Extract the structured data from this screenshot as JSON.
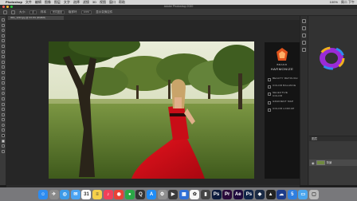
{
  "menubar": {
    "apple": "",
    "app_name": "Photoshop",
    "items": [
      "文件",
      "编辑",
      "图像",
      "图层",
      "文字",
      "选择",
      "滤镜",
      "3D",
      "视图",
      "窗口",
      "帮助"
    ],
    "right": [
      "100%",
      "周二 下午"
    ]
  },
  "window": {
    "title": "Adobe Photoshop 2020",
    "traffic_colors": [
      "#ff5f57",
      "#febc2e",
      "#28c840"
    ]
  },
  "options_bar": {
    "size_label": "大小:",
    "size_value": "点",
    "sample_label": "样本",
    "sample_value": "所有图层",
    "opacity_label": "显示变换控件",
    "strength_value": "100%",
    "extra_label": "取样环"
  },
  "document_tab": {
    "label": "IMG_1234.jpg @ 33.3% (RGB/8)"
  },
  "plugin": {
    "brand_top": "BRAND",
    "brand_name": "HARMONIZE",
    "accent": "#e0531c",
    "menu": [
      {
        "label": "BEAUTY RETOUCH"
      },
      {
        "label": "COLOR BALANCE"
      },
      {
        "label": "SELECTIVE COLOR"
      },
      {
        "label": "GRADIENT MAP"
      },
      {
        "label": "COLOR LOOKUP"
      }
    ]
  },
  "layers": {
    "header": "图层",
    "layer_name": "背景",
    "eye_icon": "eye-icon"
  },
  "dock": {
    "apps": [
      {
        "name": "finder-icon",
        "glyph": "☺",
        "color": "#2d8cf0"
      },
      {
        "name": "launchpad-icon",
        "glyph": "✈",
        "color": "#8a8a8a"
      },
      {
        "name": "safari-icon",
        "glyph": "◎",
        "color": "#3c9ae8"
      },
      {
        "name": "mail-icon",
        "glyph": "✉",
        "color": "#4aa3f2"
      },
      {
        "name": "calendar-icon",
        "glyph": "31",
        "color": "#ffffff"
      },
      {
        "name": "notes-icon",
        "glyph": "≡",
        "color": "#f5d04a"
      },
      {
        "name": "music-icon",
        "glyph": "♪",
        "color": "#f0405a"
      },
      {
        "name": "chrome-icon",
        "glyph": "◉",
        "color": "#e94235"
      },
      {
        "name": "message-icon",
        "glyph": "●",
        "color": "#2aa846"
      },
      {
        "name": "qq-icon",
        "glyph": "Q",
        "color": "#333333"
      },
      {
        "name": "appstore-icon",
        "glyph": "A",
        "color": "#1f8cf5"
      },
      {
        "name": "settings-icon",
        "glyph": "⚙",
        "color": "#8f8f8f"
      },
      {
        "name": "terminal-icon",
        "glyph": "▶",
        "color": "#3a3a3a"
      },
      {
        "name": "preview-icon",
        "glyph": "▦",
        "color": "#2f6fd6"
      },
      {
        "name": "photos-icon",
        "glyph": "✿",
        "color": "#f6f6f6"
      },
      {
        "name": "video-icon",
        "glyph": "▮",
        "color": "#444444"
      },
      {
        "name": "ps-icon",
        "glyph": "Ps",
        "color": "#0d1b3d"
      },
      {
        "name": "pr-icon",
        "glyph": "Pr",
        "color": "#2a0a3a"
      },
      {
        "name": "ae-icon",
        "glyph": "Ae",
        "color": "#1f0b3e"
      },
      {
        "name": "ps-beta-icon",
        "glyph": "Ps",
        "color": "#102448"
      },
      {
        "name": "cube-icon",
        "glyph": "◆",
        "color": "#1a2a44"
      },
      {
        "name": "inkscape-icon",
        "glyph": "▲",
        "color": "#222222"
      },
      {
        "name": "cloud-icon",
        "glyph": "☁",
        "color": "#1d3c8a"
      },
      {
        "name": "app-5-icon",
        "glyph": "5",
        "color": "#2f7fe0"
      },
      {
        "name": "folder-icon",
        "glyph": "▭",
        "color": "#4aa6ee"
      },
      {
        "name": "trash-icon",
        "glyph": "▢",
        "color": "#b9b9b9"
      }
    ]
  }
}
